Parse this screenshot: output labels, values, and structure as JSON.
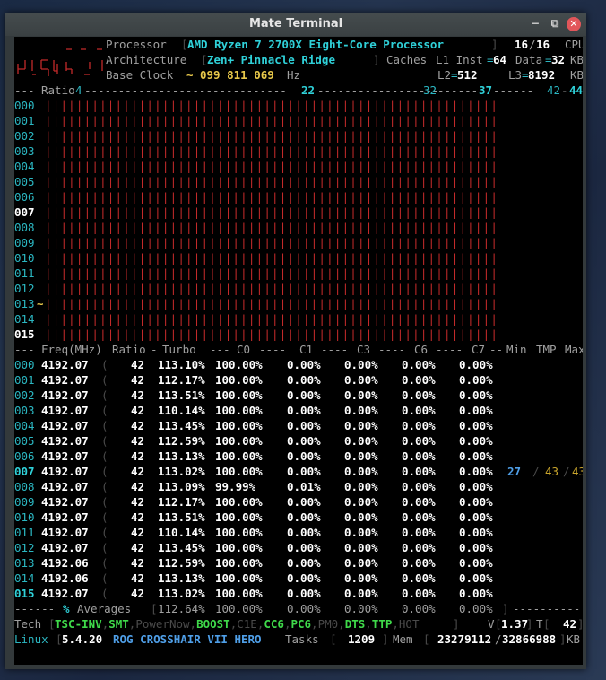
{
  "window": {
    "title": "Mate Terminal"
  },
  "header": {
    "processor_label": "Processor",
    "processor_name": "AMD Ryzen 7 2700X Eight-Core Processor",
    "threads_online": "16",
    "threads_total": "16",
    "cpu_label": "CPU",
    "architecture_label": "Architecture",
    "architecture": "Zen+ Pinnacle Ridge",
    "caches_label": "Caches",
    "l1_inst_label": "L1 Inst",
    "l1_inst": "64",
    "data_label": "Data",
    "l1_data": "32",
    "kb1": "KB",
    "base_clock_label": "Base Clock",
    "base_clock_value": "099 811 069",
    "hz": "Hz",
    "l2_label": "L2",
    "l2": "512",
    "l3_label": "L3",
    "l3": "8192",
    "kb2": "KB"
  },
  "ratio_scale": {
    "label": "Ratio",
    "marks": [
      "4",
      "22",
      "32",
      "37",
      "42",
      "44"
    ]
  },
  "cores": [
    "000",
    "001",
    "002",
    "003",
    "004",
    "005",
    "006",
    "007",
    "008",
    "009",
    "010",
    "011",
    "012",
    "013",
    "014",
    "015"
  ],
  "freq_header": {
    "freq": "Freq(MHz)",
    "ratio": "Ratio",
    "turbo": "Turbo",
    "c0": "C0",
    "c1": "C1",
    "c3": "C3",
    "c6": "C6",
    "c7": "C7",
    "min": "Min",
    "tmp": "TMP",
    "max": "Max"
  },
  "freq_rows": [
    {
      "core": "000",
      "freq": "4192.07",
      "ratio": "42",
      "turbo": "113.10%",
      "c0": "100.00%",
      "c1": "0.00%",
      "c3": "0.00%",
      "c6": "0.00%",
      "c7": "0.00%"
    },
    {
      "core": "001",
      "freq": "4192.07",
      "ratio": "42",
      "turbo": "112.17%",
      "c0": "100.00%",
      "c1": "0.00%",
      "c3": "0.00%",
      "c6": "0.00%",
      "c7": "0.00%"
    },
    {
      "core": "002",
      "freq": "4192.07",
      "ratio": "42",
      "turbo": "113.51%",
      "c0": "100.00%",
      "c1": "0.00%",
      "c3": "0.00%",
      "c6": "0.00%",
      "c7": "0.00%"
    },
    {
      "core": "003",
      "freq": "4192.07",
      "ratio": "42",
      "turbo": "110.14%",
      "c0": "100.00%",
      "c1": "0.00%",
      "c3": "0.00%",
      "c6": "0.00%",
      "c7": "0.00%"
    },
    {
      "core": "004",
      "freq": "4192.07",
      "ratio": "42",
      "turbo": "113.45%",
      "c0": "100.00%",
      "c1": "0.00%",
      "c3": "0.00%",
      "c6": "0.00%",
      "c7": "0.00%"
    },
    {
      "core": "005",
      "freq": "4192.07",
      "ratio": "42",
      "turbo": "112.59%",
      "c0": "100.00%",
      "c1": "0.00%",
      "c3": "0.00%",
      "c6": "0.00%",
      "c7": "0.00%"
    },
    {
      "core": "006",
      "freq": "4192.07",
      "ratio": "42",
      "turbo": "113.13%",
      "c0": "100.00%",
      "c1": "0.00%",
      "c3": "0.00%",
      "c6": "0.00%",
      "c7": "0.00%"
    },
    {
      "core": "007",
      "freq": "4192.07",
      "ratio": "42",
      "turbo": "113.02%",
      "c0": "100.00%",
      "c1": "0.00%",
      "c3": "0.00%",
      "c6": "0.00%",
      "c7": "0.00%",
      "min": "27",
      "tmp": "43",
      "max": "43"
    },
    {
      "core": "008",
      "freq": "4192.07",
      "ratio": "42",
      "turbo": "113.09%",
      "c0": "99.99%",
      "c1": "0.01%",
      "c3": "0.00%",
      "c6": "0.00%",
      "c7": "0.00%"
    },
    {
      "core": "009",
      "freq": "4192.07",
      "ratio": "42",
      "turbo": "112.17%",
      "c0": "100.00%",
      "c1": "0.00%",
      "c3": "0.00%",
      "c6": "0.00%",
      "c7": "0.00%"
    },
    {
      "core": "010",
      "freq": "4192.07",
      "ratio": "42",
      "turbo": "113.51%",
      "c0": "100.00%",
      "c1": "0.00%",
      "c3": "0.00%",
      "c6": "0.00%",
      "c7": "0.00%"
    },
    {
      "core": "011",
      "freq": "4192.07",
      "ratio": "42",
      "turbo": "110.14%",
      "c0": "100.00%",
      "c1": "0.00%",
      "c3": "0.00%",
      "c6": "0.00%",
      "c7": "0.00%"
    },
    {
      "core": "012",
      "freq": "4192.07",
      "ratio": "42",
      "turbo": "113.45%",
      "c0": "100.00%",
      "c1": "0.00%",
      "c3": "0.00%",
      "c6": "0.00%",
      "c7": "0.00%"
    },
    {
      "core": "013",
      "freq": "4192.06",
      "ratio": "42",
      "turbo": "112.59%",
      "c0": "100.00%",
      "c1": "0.00%",
      "c3": "0.00%",
      "c6": "0.00%",
      "c7": "0.00%"
    },
    {
      "core": "014",
      "freq": "4192.06",
      "ratio": "42",
      "turbo": "113.13%",
      "c0": "100.00%",
      "c1": "0.00%",
      "c3": "0.00%",
      "c6": "0.00%",
      "c7": "0.00%"
    },
    {
      "core": "015",
      "freq": "4192.07",
      "ratio": "42",
      "turbo": "113.02%",
      "c0": "100.00%",
      "c1": "0.00%",
      "c3": "0.00%",
      "c6": "0.00%",
      "c7": "0.00%"
    }
  ],
  "averages": {
    "pct": "%",
    "label": "Averages",
    "turbo": "112.64%",
    "c0": "100.00%",
    "c1": "0.00%",
    "c3": "0.00%",
    "c6": "0.00%",
    "c7": "0.00%"
  },
  "tech": {
    "label": "Tech",
    "features": [
      {
        "name": "TSC-INV",
        "on": true
      },
      {
        "name": "SMT",
        "on": true
      },
      {
        "name": "PowerNow",
        "on": false
      },
      {
        "name": "BOOST",
        "on": true
      },
      {
        "name": "C1E",
        "on": false
      },
      {
        "name": "CC6",
        "on": true
      },
      {
        "name": "PC6",
        "on": true
      },
      {
        "name": "PM0",
        "on": false
      },
      {
        "name": "DTS",
        "on": true
      },
      {
        "name": "TTP",
        "on": true
      },
      {
        "name": "HOT",
        "on": false
      }
    ],
    "v_label": "V",
    "voltage": "1.37",
    "t_label": "T",
    "temp": "42"
  },
  "footer": {
    "os": "Linux",
    "kernel": "5.4.20",
    "board": "ROG CROSSHAIR VII HERO",
    "tasks_label": "Tasks",
    "tasks": "1209",
    "mem_label": "Mem",
    "mem_used": "23279112",
    "mem_total": "32866988",
    "kb": "KB"
  },
  "colors": {
    "cyan": "#2fd0d8",
    "yellow": "#e8c84a",
    "green": "#3fd94a",
    "red": "#c22a2a",
    "blue": "#4f9fe8"
  }
}
